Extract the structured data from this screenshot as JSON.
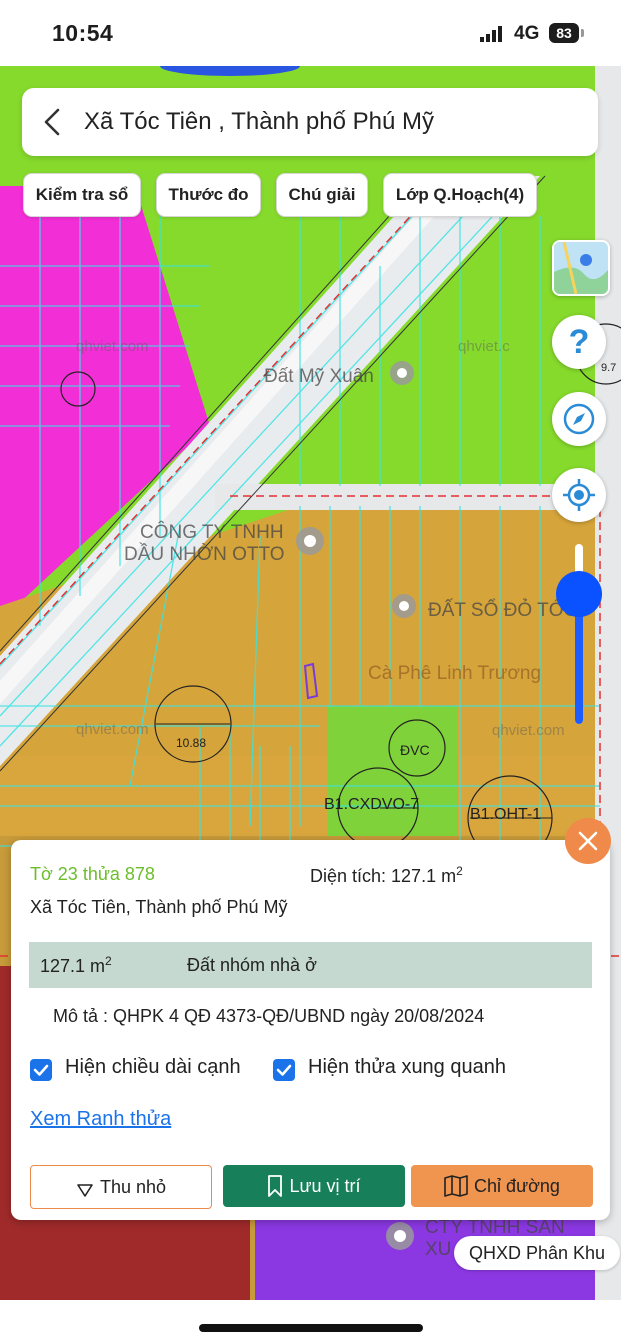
{
  "status": {
    "time": "10:54",
    "network": "4G",
    "battery": "83"
  },
  "header": {
    "title": "Xã Tóc Tiên , Thành phố Phú Mỹ",
    "back_icon": "chevron-left-icon"
  },
  "chips": [
    "Kiểm tra sổ",
    "Thước đo",
    "Chú giải",
    "Lớp Q.Hoạch(4)"
  ],
  "controls": {
    "help": "?",
    "compass_icon": "compass-icon",
    "locate_icon": "locate-icon",
    "layer_icon": "map-layer-thumbnail",
    "opacity_level": 0.72
  },
  "map": {
    "labels": {
      "poi1": "Đất Mỹ Xuân",
      "poi2_line1": "CÔNG TY TNHH",
      "poi2_line2": "DẦU NHỜN OTTO",
      "poi3": "ĐẤT SỔ ĐỎ TÓC",
      "poi4": "Cà Phê Linh Trương",
      "poi5": "CTY TNHH SẢN",
      "poi5b": "XU",
      "lot1": "10.88",
      "lot2": "ĐVC",
      "lot3": "B1.CXDVO-7",
      "lot4": "B1.OHT-1",
      "lot5": "9.7",
      "watermark": "qhviet.com",
      "watermark2": "qhviet.c"
    }
  },
  "card": {
    "parcel_id": "Tờ 23 thửa 878",
    "area_label": "Diện tích: 127.1 m",
    "area_sup": "2",
    "address": "Xã Tóc Tiên, Thành phố Phú Mỹ",
    "zone_area": "127.1 m",
    "zone_area_sup": "2",
    "zone_name": "Đất nhóm nhà ở",
    "description": "Mô tả : QHPK 4 QĐ 4373-QĐ/UBND ngày 20/08/2024",
    "checkbox1": "Hiện chiều dài cạnh",
    "checkbox2": "Hiện thửa xung quanh",
    "checkbox1_checked": true,
    "checkbox2_checked": true,
    "link": "Xem Ranh thửa",
    "btn_shrink": "Thu nhỏ",
    "btn_save": "Lưu vị trí",
    "btn_directions": "Chỉ đường"
  },
  "layer_badge": "QHXD Phân Khu",
  "colors": {
    "accent_green": "#17805a",
    "accent_orange": "#ef954f",
    "link_blue": "#1a73e8",
    "parcel_green": "#6dbd2b"
  }
}
